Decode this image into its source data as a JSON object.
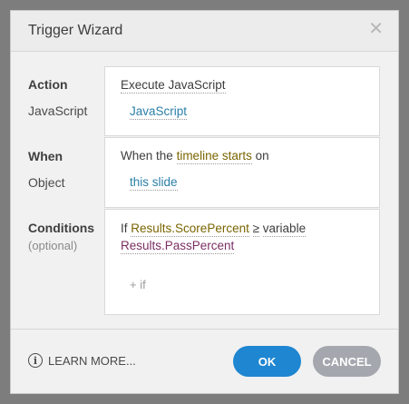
{
  "dialog": {
    "title": "Trigger Wizard",
    "close_glyph": "✕"
  },
  "action": {
    "label": "Action",
    "value": "Execute JavaScript",
    "sub_label": "JavaScript",
    "sub_value": "JavaScript"
  },
  "when": {
    "label": "When",
    "prefix": "When the",
    "event": "timeline starts",
    "suffix": "on",
    "sub_label": "Object",
    "object": "this slide"
  },
  "conditions": {
    "label": "Conditions",
    "optional_label": "(optional)",
    "if_word": "If",
    "variable1": "Results.ScorePercent",
    "operator": "≥",
    "compare_type": "variable",
    "variable2": "Results.PassPercent",
    "add_if": "+ if"
  },
  "footer": {
    "learn_more": "LEARN MORE...",
    "info_glyph": "i",
    "ok": "OK",
    "cancel": "CANCEL"
  },
  "colors": {
    "ok_button": "#1f86d1",
    "cancel_button": "#a4a8ae",
    "link_blue": "#2a7fa8",
    "link_olive": "#7a6500",
    "link_purple": "#7b2f64"
  }
}
